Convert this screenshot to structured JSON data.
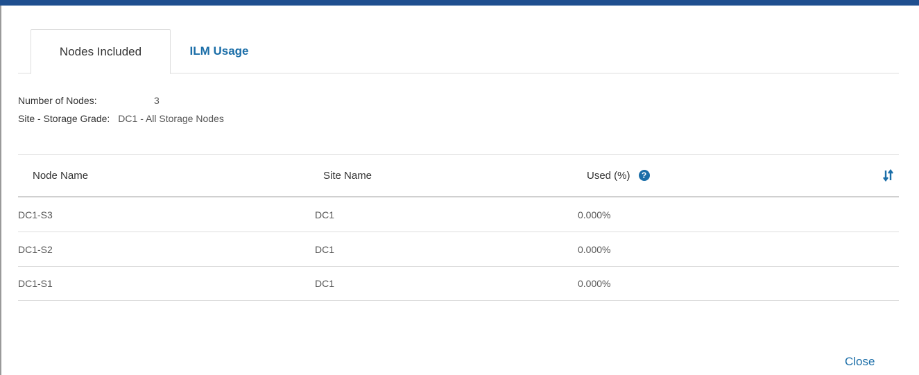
{
  "tabs": [
    {
      "label": "Nodes Included",
      "active": true
    },
    {
      "label": "ILM Usage",
      "active": false
    }
  ],
  "summary": {
    "nodes_label": "Number of Nodes:",
    "nodes_value": "3",
    "grade_label": "Site - Storage Grade:",
    "grade_value": "DC1 - All Storage Nodes"
  },
  "table": {
    "headers": {
      "node_name": "Node Name",
      "site_name": "Site Name",
      "used": "Used (%)"
    },
    "rows": [
      {
        "node": "DC1-S3",
        "site": "DC1",
        "used": "0.000%"
      },
      {
        "node": "DC1-S2",
        "site": "DC1",
        "used": "0.000%"
      },
      {
        "node": "DC1-S1",
        "site": "DC1",
        "used": "0.000%"
      }
    ]
  },
  "icons": {
    "help": "help-circle-icon",
    "sort": "sort-icon"
  },
  "colors": {
    "accent": "#1b6ea8",
    "header_bar": "#1f4f8f"
  },
  "footer": {
    "close_label": "Close"
  }
}
